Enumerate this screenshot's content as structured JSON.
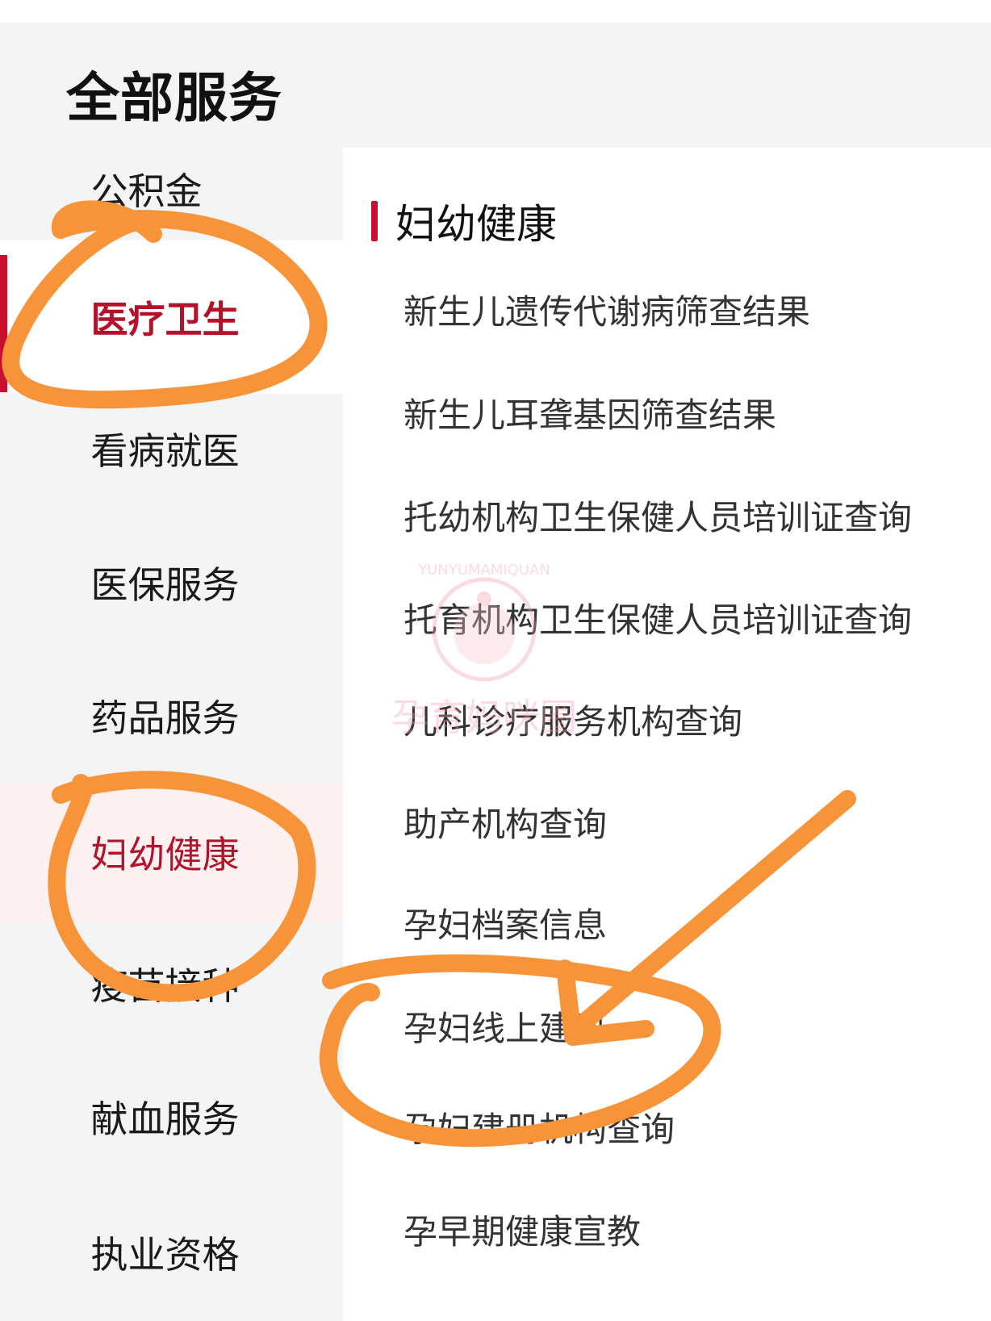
{
  "header": {
    "title": "全部服务"
  },
  "sidebar": {
    "items": [
      {
        "label": "公积金"
      },
      {
        "label": "医疗卫生"
      },
      {
        "label": "看病就医"
      },
      {
        "label": "医保服务"
      },
      {
        "label": "药品服务"
      },
      {
        "label": "妇幼健康"
      },
      {
        "label": "疫苗接种"
      },
      {
        "label": "献血服务"
      },
      {
        "label": "执业资格"
      }
    ]
  },
  "main": {
    "section_title": "妇幼健康",
    "items": [
      {
        "label": "新生儿遗传代谢病筛查结果"
      },
      {
        "label": "新生儿耳聋基因筛查结果"
      },
      {
        "label": "托幼机构卫生保健人员培训证查询"
      },
      {
        "label": "托育机构卫生保健人员培训证查询"
      },
      {
        "label": "儿科诊疗服务机构查询"
      },
      {
        "label": "助产机构查询"
      },
      {
        "label": "孕妇档案信息"
      },
      {
        "label": "孕妇线上建册"
      },
      {
        "label": "孕妇建册机构查询"
      },
      {
        "label": "孕早期健康宣教"
      }
    ]
  },
  "watermark": {
    "text": "孕育妈咪圈",
    "latin": "YUNYUMAMIQUAN"
  },
  "colors": {
    "accent": "#c8102e",
    "annotation": "#f7943a",
    "header_bg": "#f3f4f6"
  }
}
